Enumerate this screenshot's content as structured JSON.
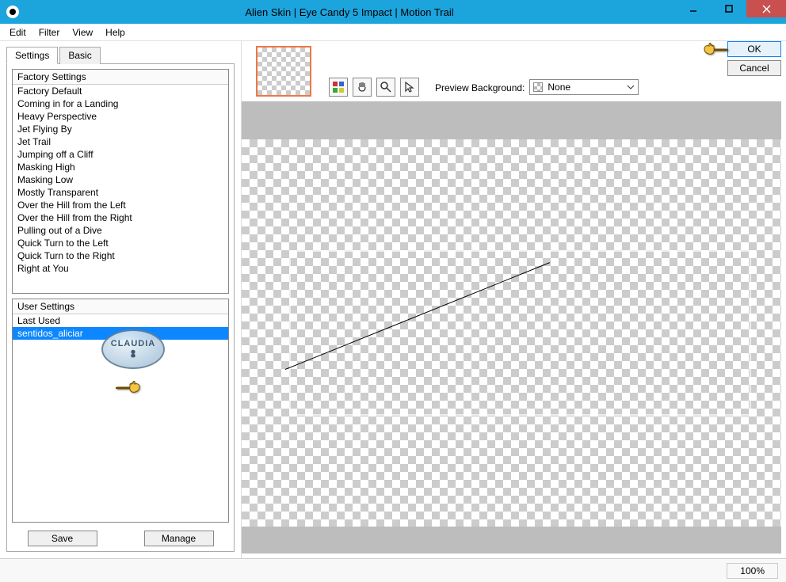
{
  "window": {
    "title": "Alien Skin | Eye Candy 5 Impact | Motion Trail"
  },
  "menu": {
    "items": [
      "Edit",
      "Filter",
      "View",
      "Help"
    ]
  },
  "tabs": {
    "settings": "Settings",
    "basic": "Basic"
  },
  "factory": {
    "header": "Factory Settings",
    "items": [
      "Factory Default",
      "Coming in for a Landing",
      "Heavy Perspective",
      "Jet Flying By",
      "Jet Trail",
      "Jumping off a Cliff",
      "Masking High",
      "Masking Low",
      "Mostly Transparent",
      "Over the Hill from the Left",
      "Over the Hill from the Right",
      "Pulling out of a Dive",
      "Quick Turn to the Left",
      "Quick Turn to the Right",
      "Right at You"
    ]
  },
  "user": {
    "header": "User Settings",
    "items": [
      {
        "label": "Last Used",
        "selected": false
      },
      {
        "label": "sentidos_aliciar",
        "selected": true
      }
    ]
  },
  "buttons": {
    "save": "Save",
    "manage": "Manage",
    "ok": "OK",
    "cancel": "Cancel"
  },
  "preview": {
    "label": "Preview Background:",
    "value": "None"
  },
  "status": {
    "zoom": "100%"
  },
  "watermark": {
    "text": "CLAUDIA"
  }
}
